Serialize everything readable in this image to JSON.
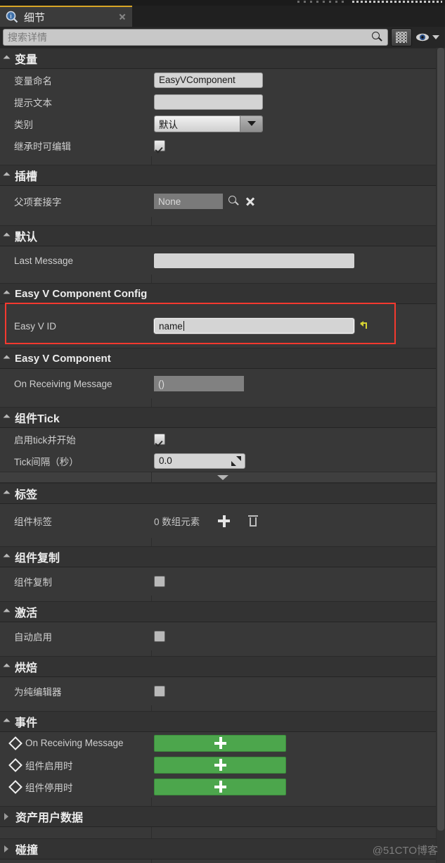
{
  "tab": {
    "icon": "info-magnifier-icon",
    "label": "细节",
    "close": "close-icon"
  },
  "search": {
    "placeholder": "搜索详情",
    "icon": "search-icon"
  },
  "toolbar": {
    "grid_icon": "grid-view-icon",
    "eye_icon": "eye-visibility-icon",
    "caret_icon": "chevron-down-icon"
  },
  "sections": [
    {
      "title": "变量",
      "expanded": true,
      "rows": [
        {
          "label": "变量命名",
          "type": "text",
          "value": "EasyVComponent"
        },
        {
          "label": "提示文本",
          "type": "text",
          "value": ""
        },
        {
          "label": "类别",
          "type": "combo",
          "value": "默认"
        },
        {
          "label": "继承时可编辑",
          "type": "checkbox",
          "checked": true
        }
      ]
    },
    {
      "title": "插槽",
      "expanded": true,
      "rows": [
        {
          "label": "父项套接字",
          "type": "object",
          "value": "None",
          "actions": [
            "browse-icon",
            "clear-icon"
          ]
        }
      ]
    },
    {
      "title": "默认",
      "expanded": true,
      "rows": [
        {
          "label": "Last Message",
          "type": "readonly-text",
          "value": ""
        }
      ]
    },
    {
      "title": "Easy V Component Config",
      "expanded": true,
      "highlighted": true,
      "rows": [
        {
          "label": "Easy V ID",
          "type": "text-focused",
          "value": "name",
          "reset": "reset-to-default-icon"
        }
      ]
    },
    {
      "title": "Easy V Component",
      "expanded": true,
      "rows": [
        {
          "label": "On Receiving Message",
          "type": "delegate",
          "value": "()"
        }
      ]
    },
    {
      "title": "组件Tick",
      "expanded": true,
      "rows": [
        {
          "label": "启用tick并开始",
          "type": "checkbox",
          "checked": true
        },
        {
          "label": "Tick间隔（秒）",
          "type": "spinner",
          "value": "0.0"
        }
      ],
      "has_collapser": true
    },
    {
      "title": "标签",
      "expanded": true,
      "rows": [
        {
          "label": "组件标签",
          "type": "array",
          "value": "0 数组元素",
          "actions": [
            "add-element-icon",
            "delete-all-icon"
          ]
        }
      ]
    },
    {
      "title": "组件复制",
      "expanded": true,
      "rows": [
        {
          "label": "组件复制",
          "type": "checkbox",
          "checked": false
        }
      ]
    },
    {
      "title": "激活",
      "expanded": true,
      "rows": [
        {
          "label": "自动启用",
          "type": "checkbox",
          "checked": false
        }
      ]
    },
    {
      "title": "烘焙",
      "expanded": true,
      "rows": [
        {
          "label": "为纯编辑器",
          "type": "checkbox",
          "checked": false
        }
      ]
    },
    {
      "title": "事件",
      "expanded": true,
      "rows": [
        {
          "label": "On Receiving Message",
          "type": "event",
          "button": "+"
        },
        {
          "label": "组件启用时",
          "type": "event",
          "button": "+"
        },
        {
          "label": "组件停用时",
          "type": "event",
          "button": "+"
        }
      ]
    },
    {
      "title": "资产用户数据",
      "expanded": false,
      "rows": []
    },
    {
      "title": "碰撞",
      "expanded": false,
      "rows": []
    }
  ],
  "colors": {
    "tab_accent": "#d8a526",
    "highlight_border": "#f4392f",
    "event_button": "#4ca64c",
    "reset_icon": "#d6d232",
    "panel_bg": "#383838"
  },
  "watermark": "@51CTO博客"
}
